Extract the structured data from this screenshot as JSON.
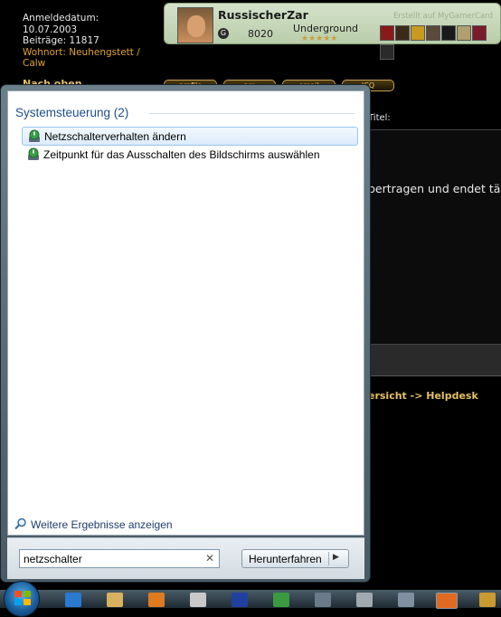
{
  "profile": {
    "registered_label": "Anmeldedatum:",
    "registered_value": "10.07.2003",
    "posts": "Beiträge: 11817",
    "location_line1": "Wohnort: Neuhengstett /",
    "location_line2": "Calw",
    "next_label": "Nach oben"
  },
  "gamercard": {
    "name": "RussischerZar",
    "credit": "Erstellt auf MyGamerCard",
    "gamerscore_icon": "G",
    "gamerscore": "8020",
    "zone": "Underground",
    "reputation_stars": "★★★★★"
  },
  "post_buttons": [
    "profile",
    "pm",
    "email",
    "ICQ"
  ],
  "background": {
    "titel_label": "Titel:",
    "body_fragment": "bertragen und endet tä",
    "breadcrumb": "ersicht -> Helpdesk"
  },
  "start_menu": {
    "section_title": "Systemsteuerung (2)",
    "results": [
      {
        "label": "Netzschalterverhalten ändern",
        "icon": "power-options-icon",
        "selected": true
      },
      {
        "label": "Zeitpunkt für das Ausschalten des Bildschirms auswählen",
        "icon": "power-options-icon",
        "selected": false
      }
    ],
    "more_results": "Weitere Ergebnisse anzeigen",
    "search_value": "netzschalter",
    "shutdown_label": "Herunterfahren"
  },
  "taskbar": {
    "icons": [
      "internet-explorer-icon",
      "explorer-folder-icon",
      "media-player-icon",
      "notepad-icon",
      "daemon-tools-icon",
      "messenger-icon",
      "network-icon",
      "quicktime-icon",
      "headset-icon",
      "firefox-icon",
      "world-of-warcraft-icon"
    ]
  },
  "colors": {
    "link_blue": "#1e4e8c",
    "selection_border": "#9bc4ee",
    "forum_gold": "#e6c060"
  }
}
